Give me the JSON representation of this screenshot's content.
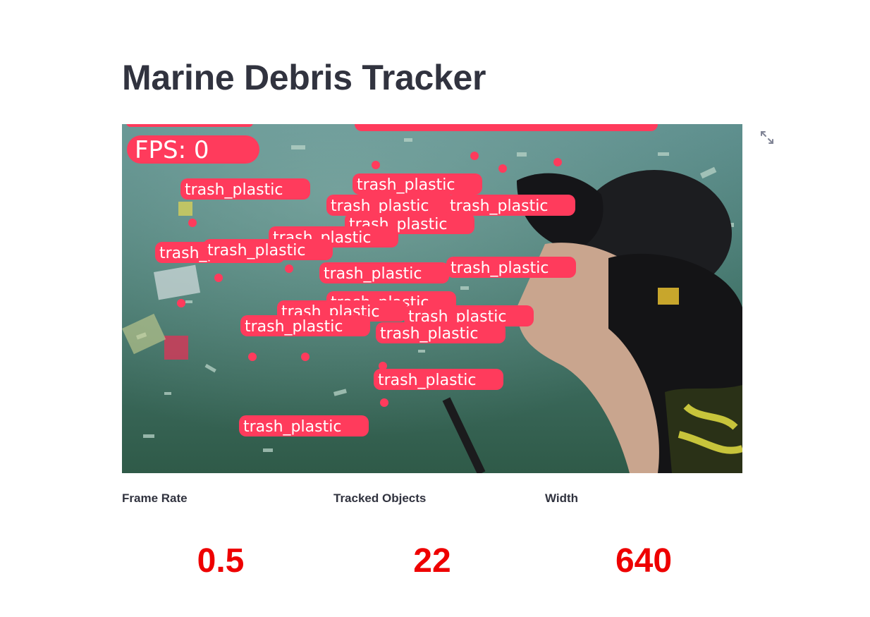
{
  "page": {
    "title": "Marine Debris Tracker"
  },
  "video": {
    "overlay_fps_text": "FPS: 0",
    "detections": [
      {
        "label": "trash_plastic"
      },
      {
        "label": "trash_plastic"
      },
      {
        "label": "trash_plastic"
      },
      {
        "label": "trash_plastic"
      },
      {
        "label": "trash_plastic"
      },
      {
        "label": "trash_plastic"
      },
      {
        "label": "trash_plastic"
      },
      {
        "label": "trash_plastic"
      },
      {
        "label": "trash_plastic"
      },
      {
        "label": "trash_plastic"
      },
      {
        "label": "trash_plastic"
      },
      {
        "label": "trash_plastic"
      },
      {
        "label": "trash_plastic"
      },
      {
        "label": "trash_plastic"
      },
      {
        "label": "trash_plastic"
      },
      {
        "label": "trash_plastic"
      },
      {
        "label": "trash_plastic"
      }
    ],
    "label_color": "#ff3b5c",
    "expand_icon": "expand-arrows-icon"
  },
  "metrics": [
    {
      "label": "Frame Rate",
      "value": "0.5"
    },
    {
      "label": "Tracked Objects",
      "value": "22"
    },
    {
      "label": "Width",
      "value": "640"
    }
  ],
  "colors": {
    "title": "#31333f",
    "metric_value": "#ee0000",
    "overlay_label": "#ff3b5c"
  }
}
